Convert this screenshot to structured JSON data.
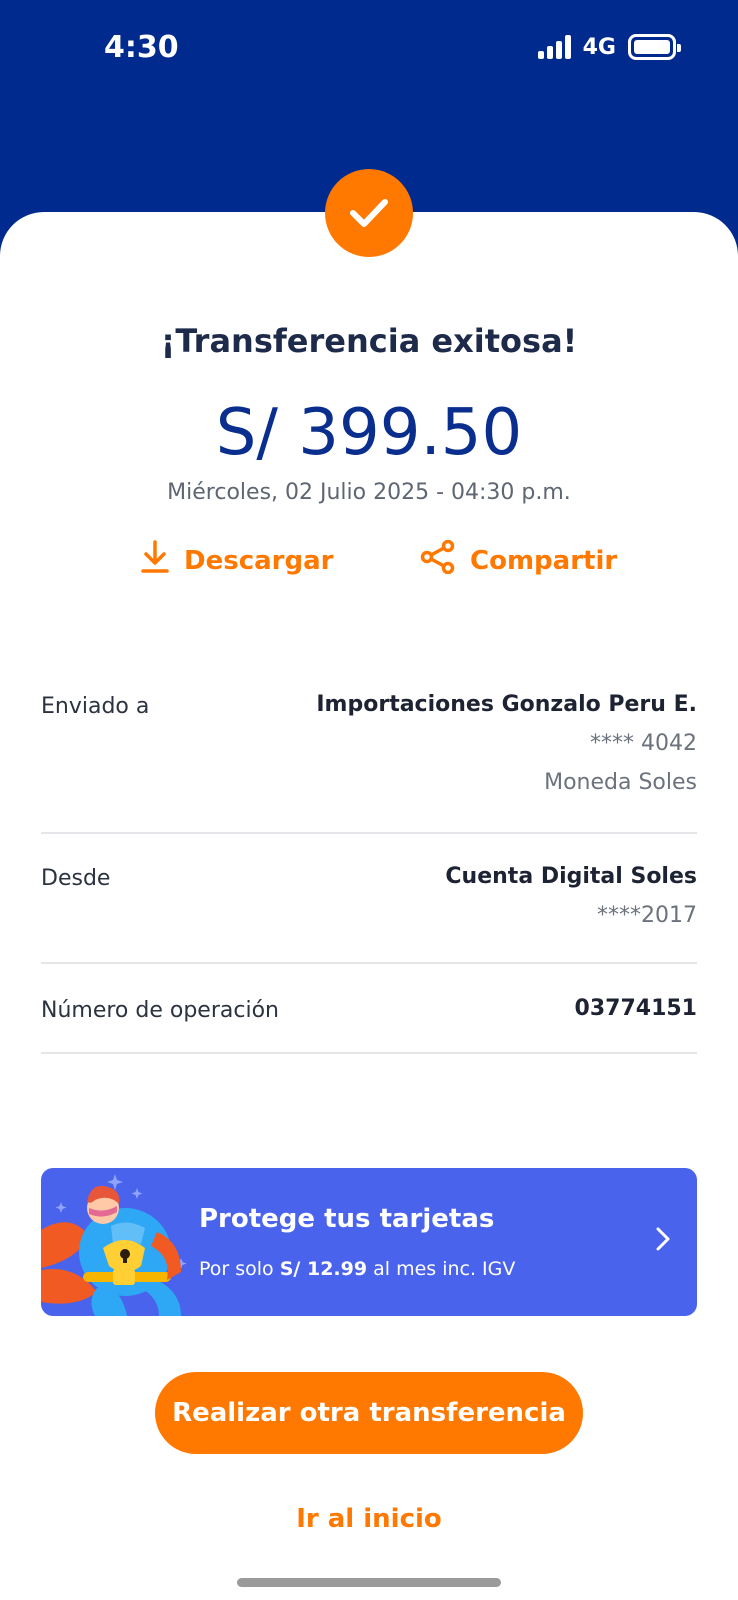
{
  "status_bar": {
    "time": "4:30",
    "network": "4G"
  },
  "receipt": {
    "title": "¡Transferencia exitosa!",
    "amount": "S/ 399.50",
    "datetime": "Miércoles, 02 Julio 2025 - 04:30 p.m."
  },
  "actions": {
    "download_label": "Descargar",
    "share_label": "Compartir"
  },
  "details": {
    "sent_to": {
      "label": "Enviado a",
      "name": "Importaciones Gonzalo Peru E.",
      "account": "**** 4042",
      "currency": "Moneda Soles"
    },
    "from": {
      "label": "Desde",
      "name": "Cuenta Digital Soles",
      "account": "****2017"
    },
    "operation": {
      "label": "Número de operación",
      "value": "03774151"
    }
  },
  "promo": {
    "title": "Protege tus tarjetas",
    "sub_prefix": "Por solo ",
    "sub_price": "S/ 12.99",
    "sub_suffix": " al mes inc. IGV"
  },
  "buttons": {
    "primary": "Realizar otra transferencia",
    "secondary": "Ir al inicio"
  },
  "colors": {
    "brand_blue": "#002a8d",
    "accent_orange": "#ff7800",
    "promo_blue": "#4a63ec"
  },
  "icons": [
    "check-icon",
    "download-icon",
    "share-icon",
    "chevron-right-icon",
    "superhero-illustration"
  ]
}
